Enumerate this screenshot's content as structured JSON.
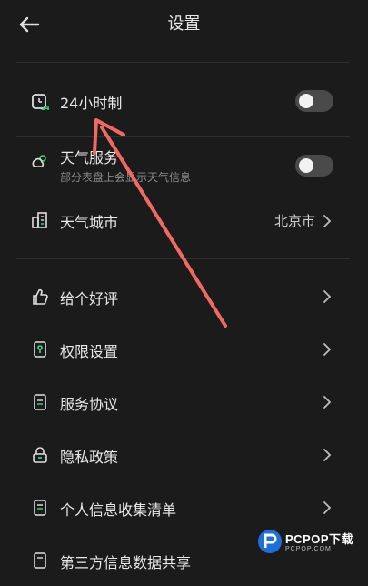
{
  "header": {
    "title": "设置"
  },
  "section1": {
    "clock_24h": {
      "label": "24小时制",
      "enabled": false
    },
    "weather_service": {
      "label": "天气服务",
      "sub": "部分表盘上会显示天气信息",
      "enabled": false
    },
    "weather_city": {
      "label": "天气城市",
      "value": "北京市"
    }
  },
  "section2": {
    "items": [
      {
        "label": "给个好评",
        "icon": "thumbs-up-icon"
      },
      {
        "label": "权限设置",
        "icon": "permission-icon"
      },
      {
        "label": "服务协议",
        "icon": "document-icon"
      },
      {
        "label": "隐私政策",
        "icon": "lock-icon"
      },
      {
        "label": "个人信息收集清单",
        "icon": "list-document-icon"
      },
      {
        "label": "第三方信息数据共享",
        "icon": "share-document-icon"
      }
    ]
  },
  "watermark": {
    "brand": "PCPOP下载",
    "sub": "PCPOP.COM"
  },
  "colors": {
    "background": "#1b1b1b",
    "annotation_arrow": "#f06a63",
    "accent_green": "#3ddc84",
    "toggle_off": "#4a4a4a"
  }
}
